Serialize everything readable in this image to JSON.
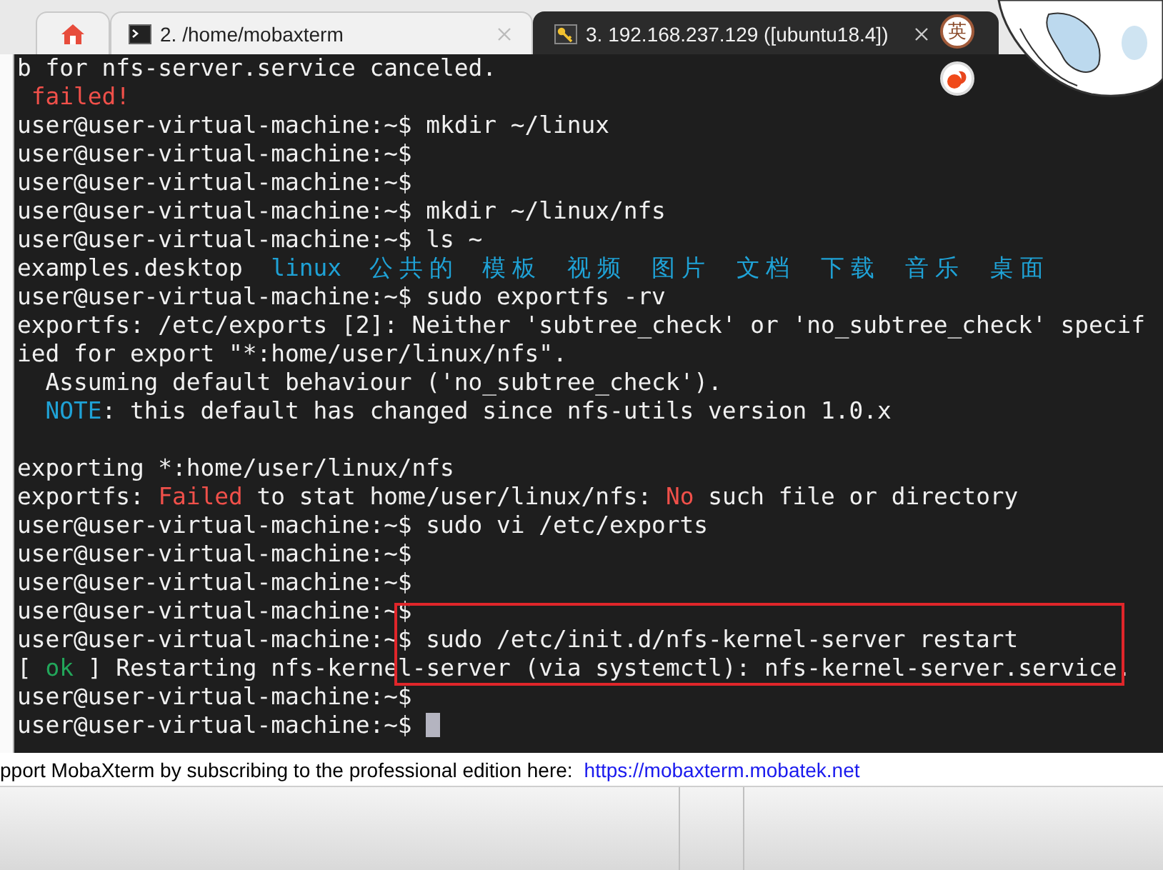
{
  "tabs": [
    {
      "kind": "home",
      "selected": false
    },
    {
      "kind": "local",
      "label": "2. /home/mobaxterm",
      "selected": false
    },
    {
      "kind": "ssh",
      "label": "3. 192.168.237.129 ([ubuntu18.4])",
      "selected": true
    }
  ],
  "ime_badge": "英",
  "terminal": {
    "lines": [
      {
        "kind": "text",
        "segments": [
          {
            "kind": "plain",
            "text": "b for nfs-server.service canceled."
          }
        ]
      },
      {
        "kind": "text",
        "segments": [
          {
            "kind": "error",
            "text": " failed!"
          }
        ]
      },
      {
        "kind": "text",
        "segments": [
          {
            "kind": "plain",
            "text": "user@user-virtual-machine:~$ mkdir ~/linux"
          }
        ]
      },
      {
        "kind": "text",
        "segments": [
          {
            "kind": "plain",
            "text": "user@user-virtual-machine:~$"
          }
        ]
      },
      {
        "kind": "text",
        "segments": [
          {
            "kind": "plain",
            "text": "user@user-virtual-machine:~$"
          }
        ]
      },
      {
        "kind": "text",
        "segments": [
          {
            "kind": "plain",
            "text": "user@user-virtual-machine:~$ mkdir ~/linux/nfs"
          }
        ]
      },
      {
        "kind": "text",
        "segments": [
          {
            "kind": "plain",
            "text": "user@user-virtual-machine:~$ ls ~"
          }
        ]
      },
      {
        "kind": "text",
        "segments": [
          {
            "kind": "plain",
            "text": "examples.desktop  "
          },
          {
            "kind": "dir",
            "text": "linux  "
          },
          {
            "kind": "dir",
            "text": "公共的  "
          },
          {
            "kind": "dir",
            "text": "模板  "
          },
          {
            "kind": "dir",
            "text": "视频  "
          },
          {
            "kind": "dir",
            "text": "图片  "
          },
          {
            "kind": "dir",
            "text": "文档  "
          },
          {
            "kind": "dir",
            "text": "下载  "
          },
          {
            "kind": "dir",
            "text": "音乐  "
          },
          {
            "kind": "dir",
            "text": "桌面"
          }
        ]
      },
      {
        "kind": "text",
        "segments": [
          {
            "kind": "plain",
            "text": "user@user-virtual-machine:~$ sudo exportfs -rv"
          }
        ]
      },
      {
        "kind": "text",
        "segments": [
          {
            "kind": "plain",
            "text": "exportfs: /etc/exports [2]: Neither 'subtree_check' or 'no_subtree_check' specif"
          }
        ]
      },
      {
        "kind": "text",
        "segments": [
          {
            "kind": "plain",
            "text": "ied for export \"*:home/user/linux/nfs\"."
          }
        ]
      },
      {
        "kind": "text",
        "segments": [
          {
            "kind": "plain",
            "text": "  Assuming default behaviour ('no_subtree_check')."
          }
        ]
      },
      {
        "kind": "text",
        "segments": [
          {
            "kind": "dir",
            "text": "  NOTE"
          },
          {
            "kind": "plain",
            "text": ": this default has changed since nfs-utils version 1.0.x"
          }
        ]
      },
      {
        "kind": "blank"
      },
      {
        "kind": "text",
        "segments": [
          {
            "kind": "plain",
            "text": "exporting *:home/user/linux/nfs"
          }
        ]
      },
      {
        "kind": "text",
        "segments": [
          {
            "kind": "plain",
            "text": "exportfs: "
          },
          {
            "kind": "error",
            "text": "Failed"
          },
          {
            "kind": "plain",
            "text": " to stat home/user/linux/nfs: "
          },
          {
            "kind": "error",
            "text": "No"
          },
          {
            "kind": "plain",
            "text": " such file or directory"
          }
        ]
      },
      {
        "kind": "text",
        "segments": [
          {
            "kind": "plain",
            "text": "user@user-virtual-machine:~$ sudo vi /etc/exports"
          }
        ]
      },
      {
        "kind": "text",
        "segments": [
          {
            "kind": "plain",
            "text": "user@user-virtual-machine:~$"
          }
        ]
      },
      {
        "kind": "text",
        "segments": [
          {
            "kind": "plain",
            "text": "user@user-virtual-machine:~$"
          }
        ]
      },
      {
        "kind": "text",
        "segments": [
          {
            "kind": "plain",
            "text": "user@user-virtual-machine:~$"
          }
        ]
      },
      {
        "kind": "text",
        "segments": [
          {
            "kind": "plain",
            "text": "user@user-virtual-machine:~$ sudo /etc/init.d/nfs-kernel-server restart"
          }
        ]
      },
      {
        "kind": "text",
        "segments": [
          {
            "kind": "plain",
            "text": "[ "
          },
          {
            "kind": "ok",
            "text": "ok"
          },
          {
            "kind": "plain",
            "text": " ] Restarting nfs-kernel-server (via systemctl): nfs-kernel-server.service."
          }
        ]
      },
      {
        "kind": "text",
        "segments": [
          {
            "kind": "plain",
            "text": "user@user-virtual-machine:~$"
          }
        ]
      },
      {
        "kind": "text",
        "segments": [
          {
            "kind": "plain",
            "text": "user@user-virtual-machine:~$ "
          }
        ]
      }
    ],
    "cursor": true,
    "highlight": {
      "kind": "rectangle"
    }
  },
  "status_bar": {
    "text": "pport MobaXterm by subscribing to the professional edition here:",
    "link": "https://mobaxterm.mobatek.net"
  }
}
